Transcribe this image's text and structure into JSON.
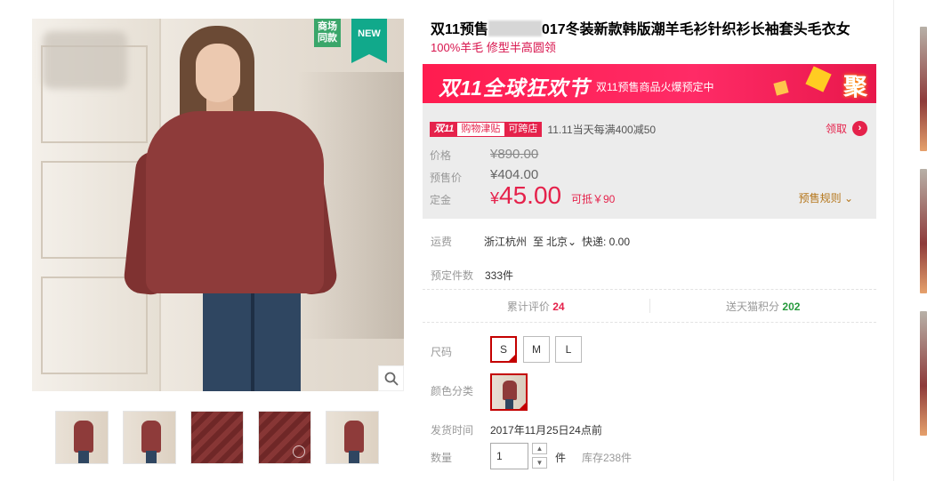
{
  "gallery": {
    "badge_same": "商场同款",
    "badge_new": "NEW",
    "zoom_icon": "magnifier-icon",
    "thumbnails": 5
  },
  "product": {
    "title_prefix": "双11预售",
    "title_suffix": "017冬装新款韩版潮羊毛衫针织衫长袖套头毛衣女",
    "subtitle": "100%羊毛 修型半高圆领"
  },
  "promo_banner": {
    "headline": "双11全球狂欢节",
    "text": "双11预售商品火爆预定中",
    "badge": "聚"
  },
  "coupon": {
    "tag_a": "双11",
    "tag_b": "购物津贴",
    "tag_c": "可跨店",
    "description": "11.11当天每满400减50",
    "get_label": "领取"
  },
  "price": {
    "original_label": "价格",
    "original_value": "¥890.00",
    "presale_label": "预售价",
    "presale_value": "¥404.00",
    "deposit_label": "定金",
    "deposit_currency": "¥",
    "deposit_value": "45.00",
    "offset_text": "可抵￥90",
    "rule_label": "预售规则"
  },
  "shipping": {
    "label": "运费",
    "from": "浙江杭州",
    "to_word": "至",
    "to": "北京",
    "fee": "快递: 0.00"
  },
  "reserved": {
    "label": "预定件数",
    "value": "333件"
  },
  "stats": {
    "reviews_label": "累计评价",
    "reviews_value": "24",
    "points_label": "送天猫积分",
    "points_value": "202"
  },
  "size": {
    "label": "尺码",
    "options": [
      "S",
      "M",
      "L"
    ],
    "selected": "S"
  },
  "color": {
    "label": "颜色分类"
  },
  "delivery": {
    "label": "发货时间",
    "value": "2017年11月25日24点前"
  },
  "quantity": {
    "label": "数量",
    "value": "1",
    "unit": "件",
    "stock": "库存238件"
  },
  "colors": {
    "accent_red": "#e5224b",
    "badge_green": "#3aa66a",
    "badge_teal": "#11a98b",
    "points_green": "#279a3d",
    "rule_brown": "#b5761a"
  }
}
